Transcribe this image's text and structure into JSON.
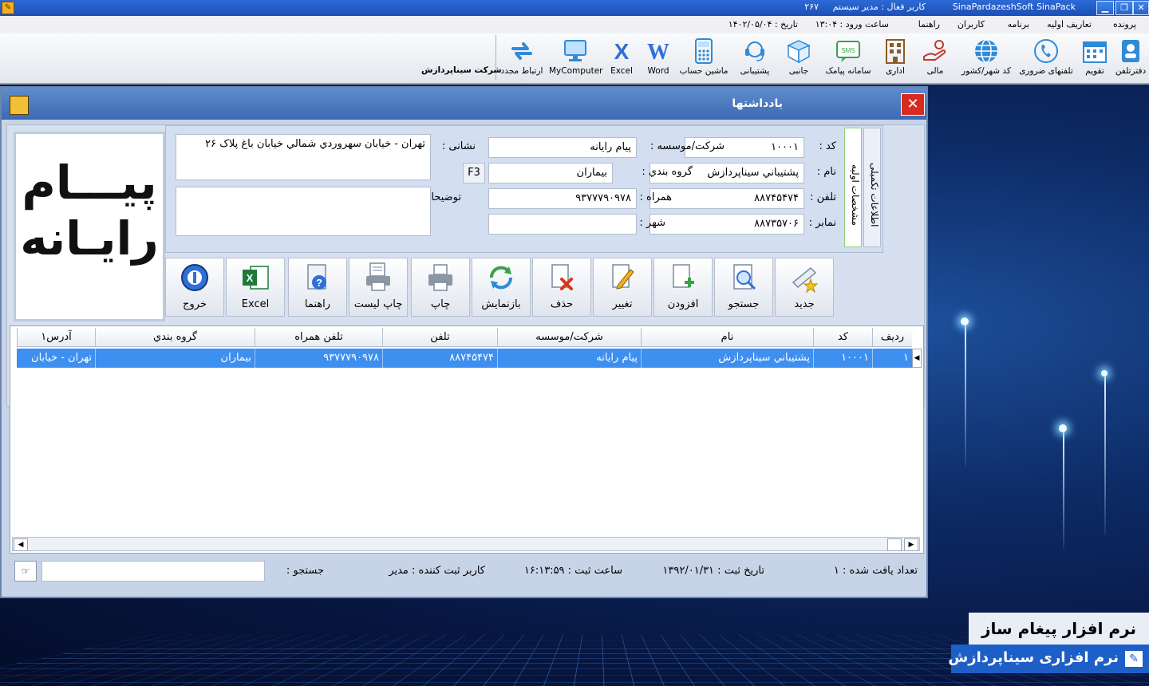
{
  "titlebar": {
    "app_name": "SinaPardazeshSoft SinaPack",
    "active_user": "کاربر فعال : مدیر سیستم",
    "counter": "۲۶۷"
  },
  "menu": {
    "items": [
      "پرونده",
      "تعاریف اولیه",
      "برنامه",
      "کاربران",
      "راهنما"
    ],
    "login_time": "ساعت ورود : ۱۳:۰۴",
    "date": "تاریخ : ۱۴۰۲/۰۵/۰۴"
  },
  "toolbar": {
    "items": [
      {
        "label": "دفترتلفن",
        "icon": "phonebook-icon"
      },
      {
        "label": "تقویم",
        "icon": "calendar-icon"
      },
      {
        "label": "تلفنهای ضروری",
        "icon": "emergency-phone-icon"
      },
      {
        "label": "کد شهر/کشور",
        "icon": "globe-icon"
      },
      {
        "label": "مالی",
        "icon": "finance-icon"
      },
      {
        "label": "اداری",
        "icon": "office-icon"
      },
      {
        "label": "سامانه پیامک",
        "icon": "sms-icon"
      },
      {
        "label": "جانبی",
        "icon": "box-icon"
      },
      {
        "label": "پشتیبانی",
        "icon": "support-headset-icon"
      },
      {
        "label": "ماشین حساب",
        "icon": "calculator-icon"
      },
      {
        "label": "Word",
        "icon": "word-icon"
      },
      {
        "label": "Excel",
        "icon": "excel-icon"
      },
      {
        "label": "MyComputer",
        "icon": "computer-icon"
      },
      {
        "label": "ارتباط مجدد",
        "icon": "reconnect-icon"
      }
    ],
    "company": "شرکت سیناپردازش"
  },
  "dialog": {
    "title": "یادداشتها",
    "logo_line1": "پیـــام",
    "logo_line2": "رایـانه",
    "tabs": [
      "اطلاعات تکمیلی",
      "مشخصات اولیه"
    ],
    "fields": {
      "code_label": "کد :",
      "code_value": "۱۰۰۰۱",
      "name_label": "نام :",
      "name_value": "پشتيباني سيناپردازش",
      "phone_label": "تلفن :",
      "phone_value": "۸۸۷۴۵۴۷۴",
      "fax_label": "نمابر :",
      "fax_value": "۸۸۷۳۵۷۰۶",
      "company_label": "شرکت/موسسه :",
      "company_value": "پيام رايانه",
      "group_label": "گروه بندي :",
      "group_value": "بيماران",
      "group_key": "F3",
      "mobile_label": "همراه :",
      "mobile_value": "۹۳۷۷۷۹۰۹۷۸",
      "city_label": "شهر :",
      "city_value": "",
      "address_label": "نشانی :",
      "address_value": "تهران - خيابان سهروردي شمالي خيابان باغ پلاک ۲۶",
      "notes_label": "توضیحات :",
      "notes_value": ""
    },
    "buttons": [
      {
        "label": "جدید",
        "icon": "new-note-icon"
      },
      {
        "label": "جستجو",
        "icon": "search-icon"
      },
      {
        "label": "افزودن",
        "icon": "add-document-icon"
      },
      {
        "label": "تغییر",
        "icon": "edit-icon"
      },
      {
        "label": "حذف",
        "icon": "delete-icon"
      },
      {
        "label": "بازنمایش",
        "icon": "refresh-icon"
      },
      {
        "label": "چاپ",
        "icon": "print-icon"
      },
      {
        "label": "چاپ لیست",
        "icon": "print-list-icon"
      },
      {
        "label": "راهنما",
        "icon": "help-icon"
      },
      {
        "label": "Excel",
        "icon": "excel-icon"
      },
      {
        "label": "خروج",
        "icon": "exit-icon"
      }
    ],
    "grid": {
      "columns": [
        "رديف",
        "کد",
        "نام",
        "شرکت/موسسه",
        "تلفن",
        "تلفن همراه",
        "گروه بندي",
        "آدرس۱"
      ],
      "rows": [
        [
          "۱",
          "۱۰۰۰۱",
          "پشتيباني سيناپردازش",
          "پيام رايانه",
          "۸۸۷۴۵۴۷۴",
          "۹۳۷۷۷۹۰۹۷۸",
          "بيماران",
          "تهران - خيابان"
        ]
      ]
    },
    "status": {
      "found": "تعداد یافت شده : ۱",
      "reg_date": "تاریخ ثبت : ۱۳۹۲/۰۱/۳۱",
      "reg_time": "ساعت ثبت : ۱۶:۱۳:۵۹",
      "reg_user": "کاربر ثبت کننده : مدیر",
      "search_label": "جستجو :"
    }
  },
  "banner": {
    "line1": "نرم افزار   پیغام ساز",
    "line2": "نرم افزاری سیناپردازش"
  }
}
